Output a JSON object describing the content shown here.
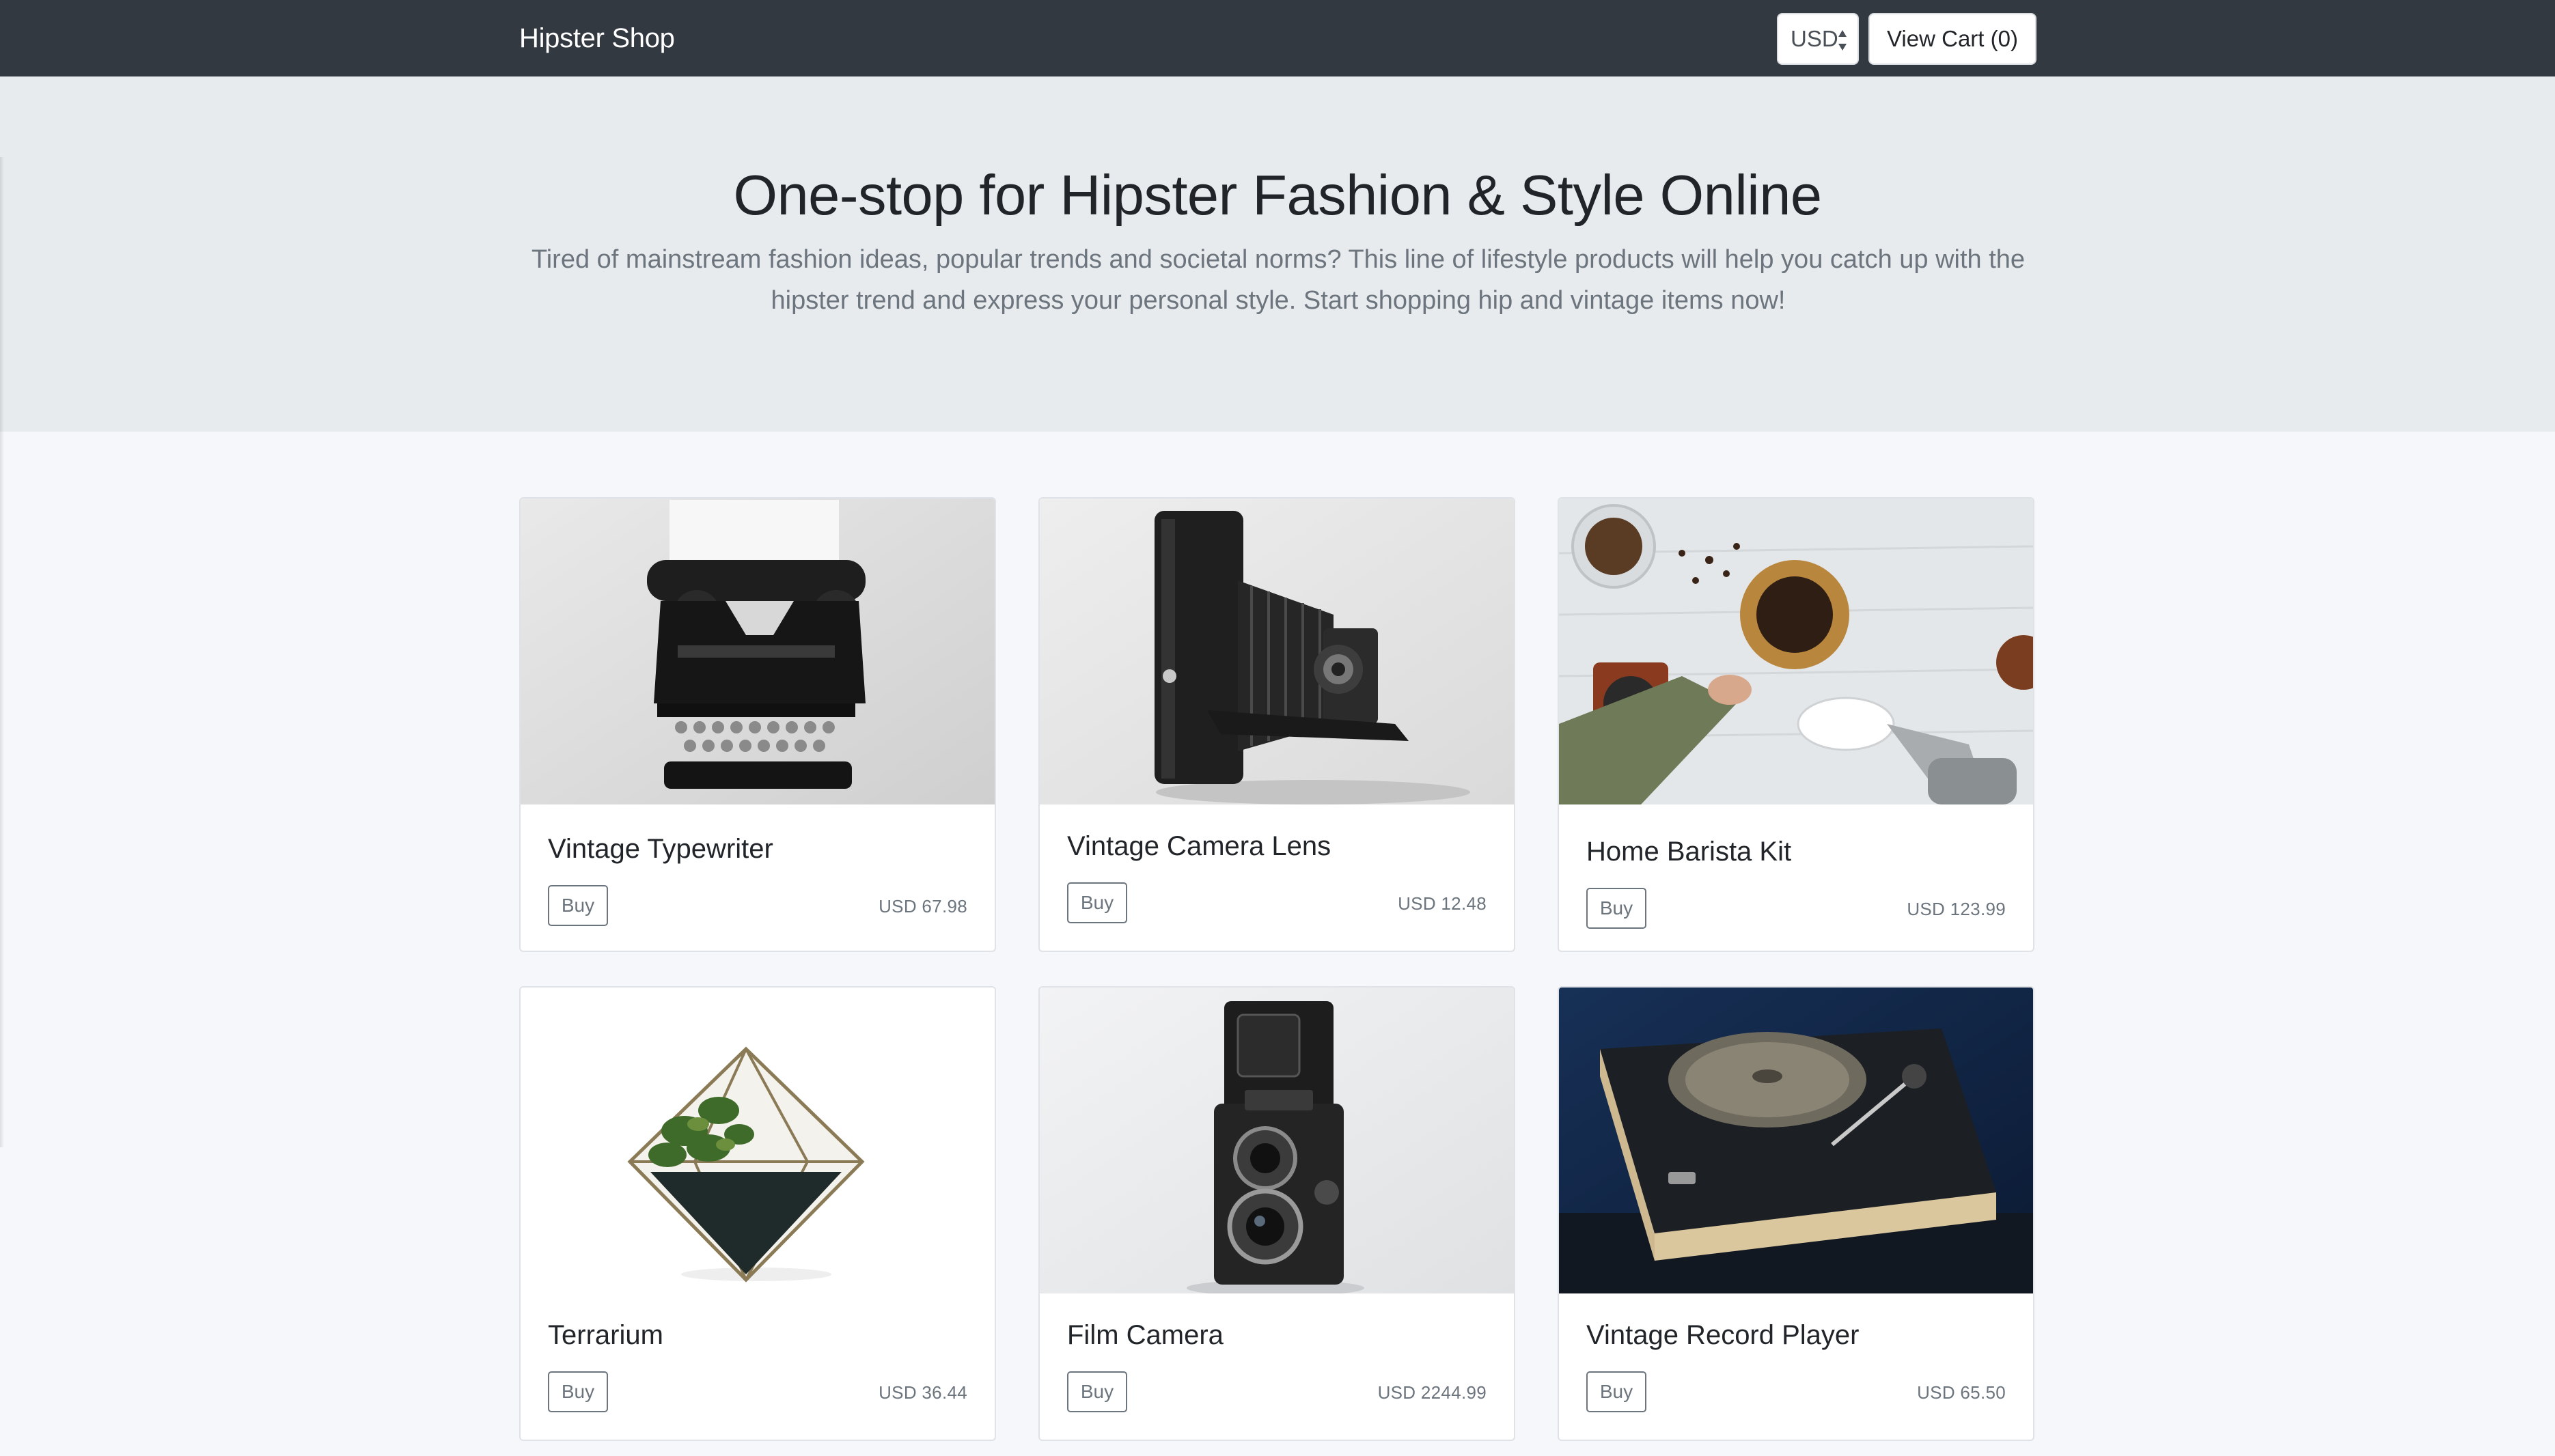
{
  "navbar": {
    "brand": "Hipster Shop",
    "currency": "USD",
    "cart_label": "View Cart (0)"
  },
  "hero": {
    "title": "One-stop for Hipster Fashion & Style Online",
    "subtitle": "Tired of mainstream fashion ideas, popular trends and societal norms? This line of lifestyle products will help you catch up with the hipster trend and express your personal style. Start shopping hip and vintage items now!"
  },
  "products": [
    {
      "name": "Vintage Typewriter",
      "buy_label": "Buy",
      "price": "USD 67.98",
      "image": "typewriter-photo"
    },
    {
      "name": "Vintage Camera Lens",
      "buy_label": "Buy",
      "price": "USD 12.48",
      "image": "folding-camera-photo"
    },
    {
      "name": "Home Barista Kit",
      "buy_label": "Buy",
      "price": "USD 123.99",
      "image": "barista-kit-photo"
    },
    {
      "name": "Terrarium",
      "buy_label": "Buy",
      "price": "USD 36.44",
      "image": "terrarium-photo"
    },
    {
      "name": "Film Camera",
      "buy_label": "Buy",
      "price": "USD 2244.99",
      "image": "film-camera-photo"
    },
    {
      "name": "Vintage Record Player",
      "buy_label": "Buy",
      "price": "USD 65.50",
      "image": "record-player-photo"
    }
  ],
  "colors": {
    "navbar_bg": "#333940",
    "hero_bg": "#e8ebee",
    "page_bg": "#f5f7fa",
    "muted_text": "#6c757d"
  }
}
